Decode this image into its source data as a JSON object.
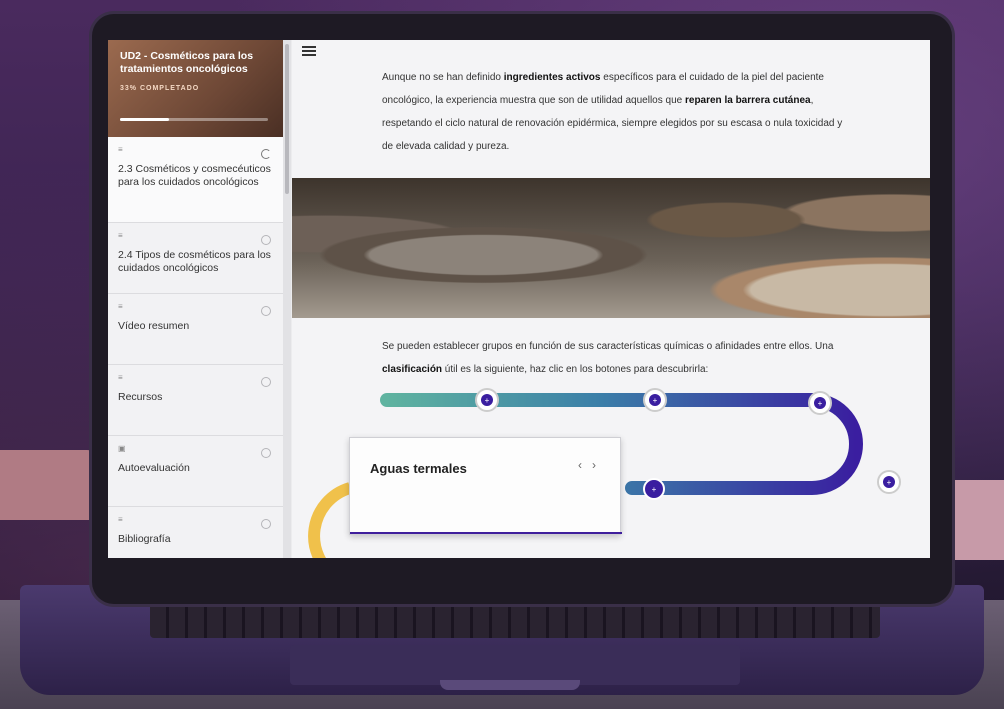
{
  "course": {
    "title": "UD2 - Cosméticos para los tratamientos oncológicos",
    "progress_label": "33% COMPLETADO",
    "progress": 0.33
  },
  "sidebar": {
    "items": [
      {
        "label": "2.3 Cosméticos y cosmecéuticos para los cuidados oncológicos",
        "icon": "doc-lines-icon",
        "status": "in-progress"
      },
      {
        "label": "2.4 Tipos de cosméticos para los cuidados oncológicos",
        "icon": "doc-lines-icon",
        "status": "not-started"
      },
      {
        "label": "Vídeo resumen",
        "icon": "doc-lines-icon",
        "status": "not-started"
      },
      {
        "label": "Recursos",
        "icon": "doc-lines-icon",
        "status": "not-started"
      },
      {
        "label": "Autoevaluación",
        "icon": "quiz-icon",
        "status": "not-started"
      },
      {
        "label": "Bibliografía",
        "icon": "doc-lines-icon",
        "status": "not-started"
      }
    ]
  },
  "content": {
    "para1": {
      "t1": "Aunque no se han definido ",
      "b1": "ingredientes activos",
      "t2": " específicos para el cuidado de la piel del paciente oncológico, la experiencia muestra que son de utilidad aquellos que ",
      "b2": "reparen la barrera cutánea",
      "t3": ", respetando el ciclo natural de renovación epidérmica, siempre elegidos por su escasa o nula toxicidad y de elevada calidad y pureza."
    },
    "para2": {
      "t1": "Se pueden establecer grupos en función de sus características químicas o afinidades entre ellos. Una ",
      "b1": "clasificación",
      "t2": " útil es la siguiente, haz clic en los botones para descubrirla:"
    },
    "card": {
      "title": "Aguas termales",
      "prev": "‹",
      "next": "›"
    },
    "timeline_button_symbol": "+"
  },
  "colors": {
    "accent": "#3f1f9c",
    "teal": "#5fb3a0",
    "purple": "#5a2a8c",
    "yellow": "#f0c14b"
  }
}
